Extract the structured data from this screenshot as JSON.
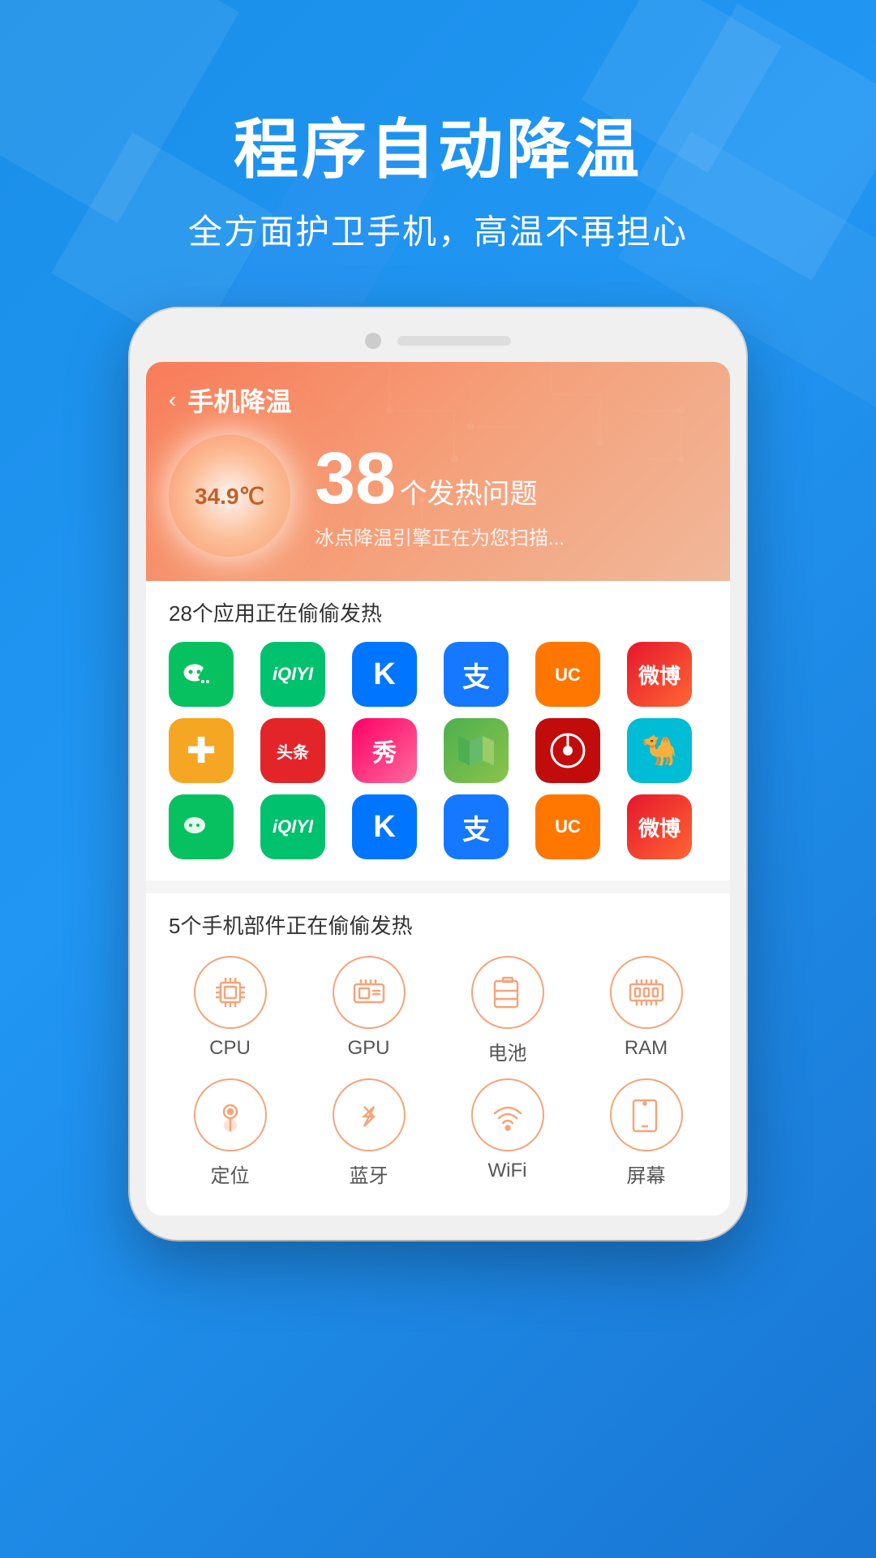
{
  "background": {
    "gradient_start": "#1a8fe8",
    "gradient_end": "#1565c0"
  },
  "header": {
    "title": "程序自动降温",
    "subtitle": "全方面护卫手机，高温不再担心"
  },
  "phone": {
    "app": {
      "nav": {
        "back_icon": "‹",
        "title": "手机降温"
      },
      "temperature": {
        "value": "34.9℃",
        "issue_count": "38",
        "issue_label": "个发热问题",
        "scanning_text": "冰点降温引擎正在为您扫描..."
      },
      "apps_section": {
        "title": "28个应用正在偷偷发热",
        "apps": [
          {
            "name": "微信",
            "icon": "💬",
            "class": "wechat"
          },
          {
            "name": "爱奇艺",
            "icon": "▶",
            "class": "iqiyi"
          },
          {
            "name": "酷狗",
            "icon": "K",
            "class": "kugou"
          },
          {
            "name": "支付宝",
            "icon": "支",
            "class": "alipay"
          },
          {
            "name": "UC",
            "icon": "UC",
            "class": "uc"
          },
          {
            "name": "微博",
            "icon": "微",
            "class": "weibo"
          },
          {
            "name": "健康",
            "icon": "✚",
            "class": "health"
          },
          {
            "name": "头条",
            "icon": "头条",
            "class": "toutiao"
          },
          {
            "name": "秀",
            "icon": "秀",
            "class": "xiu"
          },
          {
            "name": "地图",
            "icon": "📍",
            "class": "maps"
          },
          {
            "name": "网易云",
            "icon": "♫",
            "class": "netease"
          },
          {
            "name": "骆驼",
            "icon": "🐪",
            "class": "camel"
          },
          {
            "name": "微信2",
            "icon": "💬",
            "class": "wechat"
          },
          {
            "name": "爱奇艺2",
            "icon": "▶",
            "class": "iqiyi"
          },
          {
            "name": "酷狗2",
            "icon": "K",
            "class": "kugou"
          },
          {
            "name": "支付宝2",
            "icon": "支",
            "class": "alipay"
          },
          {
            "name": "UC2",
            "icon": "UC",
            "class": "uc"
          },
          {
            "name": "微博2",
            "icon": "微",
            "class": "weibo"
          }
        ]
      },
      "components_section": {
        "title": "5个手机部件正在偷偷发热",
        "components": [
          {
            "name": "CPU",
            "icon": "cpu"
          },
          {
            "name": "GPU",
            "icon": "gpu"
          },
          {
            "name": "电池",
            "icon": "battery"
          },
          {
            "name": "RAM",
            "icon": "ram"
          }
        ],
        "components_row2": [
          {
            "name": "定位",
            "icon": "location"
          },
          {
            "name": "蓝牙",
            "icon": "bluetooth"
          },
          {
            "name": "WiFi",
            "icon": "wifi"
          },
          {
            "name": "屏幕",
            "icon": "screen"
          }
        ]
      }
    }
  }
}
